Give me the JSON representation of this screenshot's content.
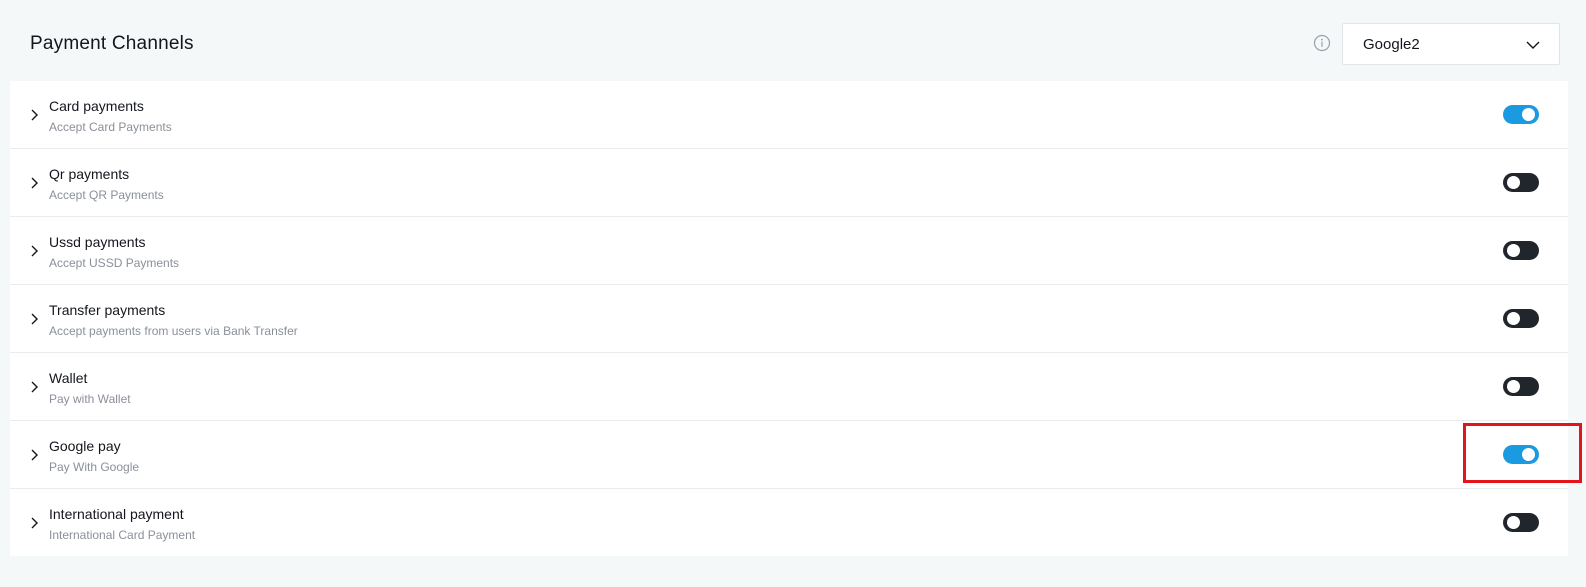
{
  "header": {
    "title": "Payment Channels",
    "info_icon": "info-circle-icon",
    "account_select": {
      "value": "Google2",
      "icon": "chevron-down-icon"
    }
  },
  "colors": {
    "toggle_on": "#1a9ae0",
    "toggle_off": "#21262d",
    "highlight": "#e5131a"
  },
  "channels": [
    {
      "title": "Card payments",
      "subtitle": "Accept Card Payments",
      "enabled": true
    },
    {
      "title": "Qr payments",
      "subtitle": "Accept QR Payments",
      "enabled": false
    },
    {
      "title": "Ussd payments",
      "subtitle": "Accept USSD Payments",
      "enabled": false
    },
    {
      "title": "Transfer payments",
      "subtitle": "Accept payments from users via Bank Transfer",
      "enabled": false
    },
    {
      "title": "Wallet",
      "subtitle": "Pay with Wallet",
      "enabled": false
    },
    {
      "title": "Google pay",
      "subtitle": "Pay With Google",
      "enabled": true,
      "highlighted": true
    },
    {
      "title": "International payment",
      "subtitle": "International Card Payment",
      "enabled": false
    }
  ]
}
